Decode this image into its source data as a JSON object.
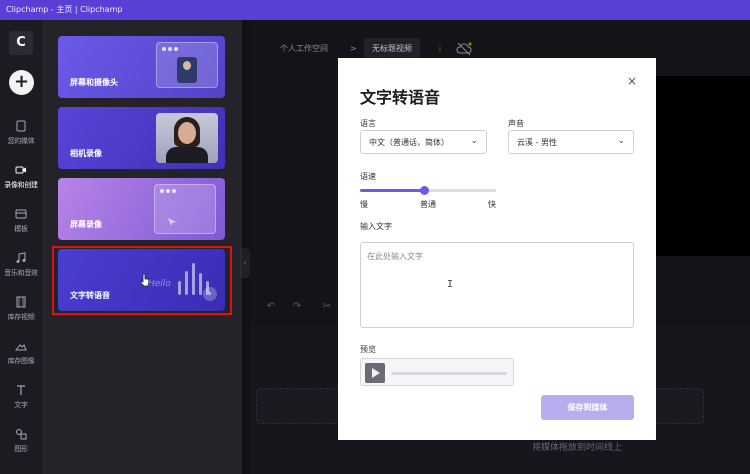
{
  "window": {
    "title": "Clipchamp - 主页 | Clipchamp"
  },
  "rail": {
    "logo": "C",
    "add_label": "+",
    "items": [
      {
        "label": "您的媒体",
        "icon": "media-icon"
      },
      {
        "label": "录像和创建",
        "icon": "camera-icon"
      },
      {
        "label": "模板",
        "icon": "template-icon"
      },
      {
        "label": "音乐和音效",
        "icon": "music-icon"
      },
      {
        "label": "库存视频",
        "icon": "film-icon"
      },
      {
        "label": "库存图像",
        "icon": "image-icon"
      },
      {
        "label": "文字",
        "icon": "text-icon"
      },
      {
        "label": "图形",
        "icon": "shapes-icon"
      }
    ]
  },
  "panel": {
    "cards": [
      {
        "title": "屏幕和摄像头"
      },
      {
        "title": "相机录像"
      },
      {
        "title": "屏幕录像"
      },
      {
        "title": "文字转语音",
        "decoration_text": "Hello"
      }
    ]
  },
  "editor": {
    "breadcrumb": "个人工作空间",
    "breadcrumb_sep": ">",
    "project_title": "无标题视频",
    "more": "⋮",
    "drop_hint": "将媒体拖放到时间线上"
  },
  "dialog": {
    "title": "文字转语音",
    "close": "×",
    "language_label": "语言",
    "language_value": "中文（普通话，简体）",
    "voice_label": "声音",
    "voice_value": "云溪 - 男性",
    "speed_label": "语速",
    "speed_value": 0.47,
    "speed_slow": "慢",
    "speed_normal": "普通",
    "speed_fast": "快",
    "input_label": "输入文字",
    "input_placeholder": "在此处输入文字",
    "preview_label": "预览",
    "save_label": "保存到媒体"
  },
  "colors": {
    "accent": "#6b5ce8",
    "titlebar": "#5a3fd6",
    "highlight": "#d81414"
  }
}
